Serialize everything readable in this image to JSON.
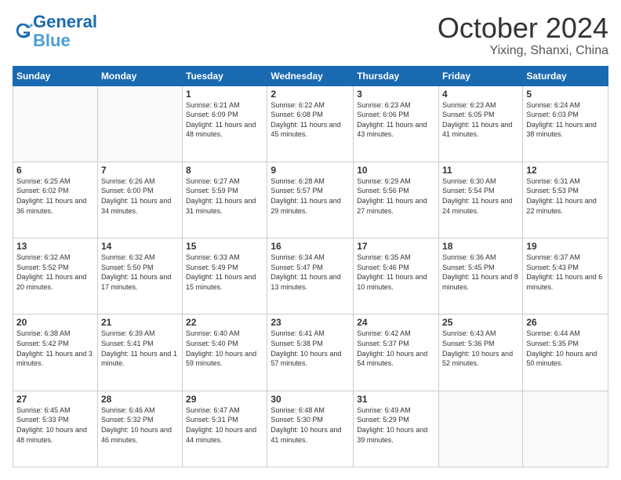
{
  "logo": {
    "line1": "General",
    "line2": "Blue"
  },
  "title": "October 2024",
  "subtitle": "Yixing, Shanxi, China",
  "days_header": [
    "Sunday",
    "Monday",
    "Tuesday",
    "Wednesday",
    "Thursday",
    "Friday",
    "Saturday"
  ],
  "weeks": [
    [
      {
        "day": "",
        "sunrise": "",
        "sunset": "",
        "daylight": ""
      },
      {
        "day": "",
        "sunrise": "",
        "sunset": "",
        "daylight": ""
      },
      {
        "day": "1",
        "sunrise": "Sunrise: 6:21 AM",
        "sunset": "Sunset: 6:09 PM",
        "daylight": "Daylight: 11 hours and 48 minutes."
      },
      {
        "day": "2",
        "sunrise": "Sunrise: 6:22 AM",
        "sunset": "Sunset: 6:08 PM",
        "daylight": "Daylight: 11 hours and 45 minutes."
      },
      {
        "day": "3",
        "sunrise": "Sunrise: 6:23 AM",
        "sunset": "Sunset: 6:06 PM",
        "daylight": "Daylight: 11 hours and 43 minutes."
      },
      {
        "day": "4",
        "sunrise": "Sunrise: 6:23 AM",
        "sunset": "Sunset: 6:05 PM",
        "daylight": "Daylight: 11 hours and 41 minutes."
      },
      {
        "day": "5",
        "sunrise": "Sunrise: 6:24 AM",
        "sunset": "Sunset: 6:03 PM",
        "daylight": "Daylight: 11 hours and 38 minutes."
      }
    ],
    [
      {
        "day": "6",
        "sunrise": "Sunrise: 6:25 AM",
        "sunset": "Sunset: 6:02 PM",
        "daylight": "Daylight: 11 hours and 36 minutes."
      },
      {
        "day": "7",
        "sunrise": "Sunrise: 6:26 AM",
        "sunset": "Sunset: 6:00 PM",
        "daylight": "Daylight: 11 hours and 34 minutes."
      },
      {
        "day": "8",
        "sunrise": "Sunrise: 6:27 AM",
        "sunset": "Sunset: 5:59 PM",
        "daylight": "Daylight: 11 hours and 31 minutes."
      },
      {
        "day": "9",
        "sunrise": "Sunrise: 6:28 AM",
        "sunset": "Sunset: 5:57 PM",
        "daylight": "Daylight: 11 hours and 29 minutes."
      },
      {
        "day": "10",
        "sunrise": "Sunrise: 6:29 AM",
        "sunset": "Sunset: 5:56 PM",
        "daylight": "Daylight: 11 hours and 27 minutes."
      },
      {
        "day": "11",
        "sunrise": "Sunrise: 6:30 AM",
        "sunset": "Sunset: 5:54 PM",
        "daylight": "Daylight: 11 hours and 24 minutes."
      },
      {
        "day": "12",
        "sunrise": "Sunrise: 6:31 AM",
        "sunset": "Sunset: 5:53 PM",
        "daylight": "Daylight: 11 hours and 22 minutes."
      }
    ],
    [
      {
        "day": "13",
        "sunrise": "Sunrise: 6:32 AM",
        "sunset": "Sunset: 5:52 PM",
        "daylight": "Daylight: 11 hours and 20 minutes."
      },
      {
        "day": "14",
        "sunrise": "Sunrise: 6:32 AM",
        "sunset": "Sunset: 5:50 PM",
        "daylight": "Daylight: 11 hours and 17 minutes."
      },
      {
        "day": "15",
        "sunrise": "Sunrise: 6:33 AM",
        "sunset": "Sunset: 5:49 PM",
        "daylight": "Daylight: 11 hours and 15 minutes."
      },
      {
        "day": "16",
        "sunrise": "Sunrise: 6:34 AM",
        "sunset": "Sunset: 5:47 PM",
        "daylight": "Daylight: 11 hours and 13 minutes."
      },
      {
        "day": "17",
        "sunrise": "Sunrise: 6:35 AM",
        "sunset": "Sunset: 5:46 PM",
        "daylight": "Daylight: 11 hours and 10 minutes."
      },
      {
        "day": "18",
        "sunrise": "Sunrise: 6:36 AM",
        "sunset": "Sunset: 5:45 PM",
        "daylight": "Daylight: 11 hours and 8 minutes."
      },
      {
        "day": "19",
        "sunrise": "Sunrise: 6:37 AM",
        "sunset": "Sunset: 5:43 PM",
        "daylight": "Daylight: 11 hours and 6 minutes."
      }
    ],
    [
      {
        "day": "20",
        "sunrise": "Sunrise: 6:38 AM",
        "sunset": "Sunset: 5:42 PM",
        "daylight": "Daylight: 11 hours and 3 minutes."
      },
      {
        "day": "21",
        "sunrise": "Sunrise: 6:39 AM",
        "sunset": "Sunset: 5:41 PM",
        "daylight": "Daylight: 11 hours and 1 minute."
      },
      {
        "day": "22",
        "sunrise": "Sunrise: 6:40 AM",
        "sunset": "Sunset: 5:40 PM",
        "daylight": "Daylight: 10 hours and 59 minutes."
      },
      {
        "day": "23",
        "sunrise": "Sunrise: 6:41 AM",
        "sunset": "Sunset: 5:38 PM",
        "daylight": "Daylight: 10 hours and 57 minutes."
      },
      {
        "day": "24",
        "sunrise": "Sunrise: 6:42 AM",
        "sunset": "Sunset: 5:37 PM",
        "daylight": "Daylight: 10 hours and 54 minutes."
      },
      {
        "day": "25",
        "sunrise": "Sunrise: 6:43 AM",
        "sunset": "Sunset: 5:36 PM",
        "daylight": "Daylight: 10 hours and 52 minutes."
      },
      {
        "day": "26",
        "sunrise": "Sunrise: 6:44 AM",
        "sunset": "Sunset: 5:35 PM",
        "daylight": "Daylight: 10 hours and 50 minutes."
      }
    ],
    [
      {
        "day": "27",
        "sunrise": "Sunrise: 6:45 AM",
        "sunset": "Sunset: 5:33 PM",
        "daylight": "Daylight: 10 hours and 48 minutes."
      },
      {
        "day": "28",
        "sunrise": "Sunrise: 6:46 AM",
        "sunset": "Sunset: 5:32 PM",
        "daylight": "Daylight: 10 hours and 46 minutes."
      },
      {
        "day": "29",
        "sunrise": "Sunrise: 6:47 AM",
        "sunset": "Sunset: 5:31 PM",
        "daylight": "Daylight: 10 hours and 44 minutes."
      },
      {
        "day": "30",
        "sunrise": "Sunrise: 6:48 AM",
        "sunset": "Sunset: 5:30 PM",
        "daylight": "Daylight: 10 hours and 41 minutes."
      },
      {
        "day": "31",
        "sunrise": "Sunrise: 6:49 AM",
        "sunset": "Sunset: 5:29 PM",
        "daylight": "Daylight: 10 hours and 39 minutes."
      },
      {
        "day": "",
        "sunrise": "",
        "sunset": "",
        "daylight": ""
      },
      {
        "day": "",
        "sunrise": "",
        "sunset": "",
        "daylight": ""
      }
    ]
  ]
}
